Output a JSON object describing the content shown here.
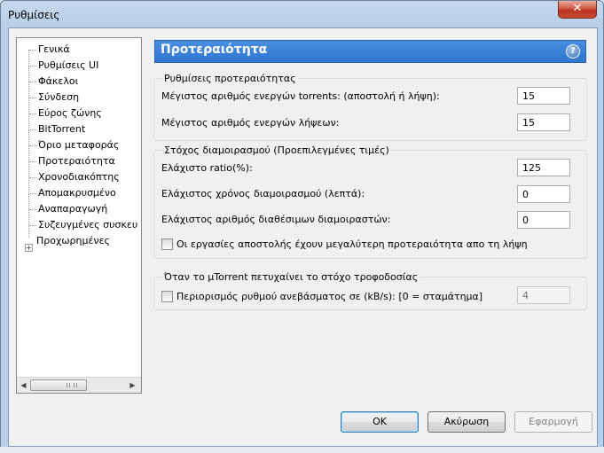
{
  "window": {
    "title": "Ρυθμίσεις",
    "close_glyph": "✕"
  },
  "tree": {
    "items": [
      {
        "label": "Γενικά"
      },
      {
        "label": "Ρυθμίσεις UI"
      },
      {
        "label": "Φάκελοι"
      },
      {
        "label": "Σύνδεση"
      },
      {
        "label": "Εύρος ζώνης"
      },
      {
        "label": "BitTorrent"
      },
      {
        "label": "Όριο μεταφοράς"
      },
      {
        "label": "Προτεραιότητα"
      },
      {
        "label": "Χρονοδιακόπτης"
      },
      {
        "label": "Απομακρυσμένο"
      },
      {
        "label": "Αναπαραγωγή"
      },
      {
        "label": "Συζευγμένες συσκευ"
      },
      {
        "label": "Προχωρημένες",
        "expandable": true
      }
    ],
    "selected": "Προτεραιότητα"
  },
  "panel": {
    "title": "Προτεραιότητα",
    "help_glyph": "?"
  },
  "queue_settings": {
    "group_label": "Ρυθμίσεις προτεραιότητας",
    "max_active_torrents_label": "Μέγιστος αριθμός ενεργών torrents: (αποστολή ή λήψη):",
    "max_active_torrents_value": "15",
    "max_active_downloads_label": "Μέγιστος αριθμός ενεργών λήψεων:",
    "max_active_downloads_value": "15"
  },
  "seeding_goal": {
    "group_label": "Στόχος διαμοιρασμού (Προεπιλεγμένες τιμές)",
    "min_ratio_label": "Ελάχιστο ratio(%):",
    "min_ratio_value": "125",
    "min_seed_time_label": "Ελάχιστος χρόνος διαμοιρασμού (λεπτά):",
    "min_seed_time_value": "0",
    "min_seeders_label": "Ελάχιστος αριθμός διαθέσιμων διαμοιραστών:",
    "min_seeders_value": "0",
    "seed_priority_label": "Οι εργασίες αποστολής έχουν μεγαλύτερη προτεραιότητα απο τη λήψη",
    "seed_priority_checked": false
  },
  "goal_reached": {
    "group_label": "Όταν το μTorrent πετυχαίνει το στόχο τροφοδοσίας",
    "limit_upload_label": "Περιορισμός ρυθμού ανεβάσματος σε (kB/s): [0 = σταμάτημα]",
    "limit_upload_checked": false,
    "limit_upload_value": "4"
  },
  "buttons": {
    "ok": "OK",
    "cancel": "Ακύρωση",
    "apply": "Εφαρμογή"
  },
  "colors": {
    "header_blue": "#3a7fd5",
    "window_frame": "#b9d1ea"
  }
}
